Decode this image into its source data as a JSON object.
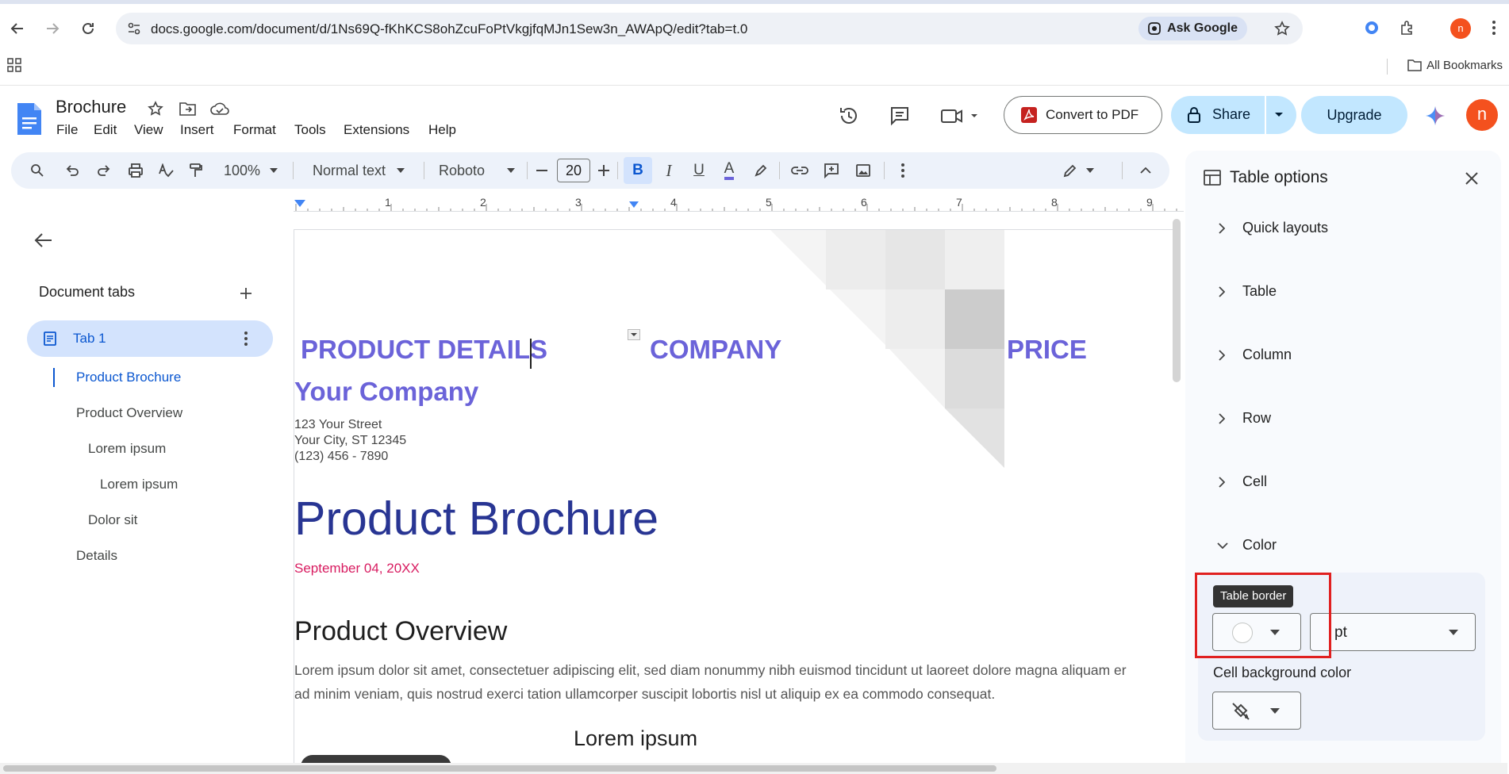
{
  "browser": {
    "url": "docs.google.com/document/d/1Ns69Q-fKhKCS8ohZcuFoPtVkgjfqMJn1Sew3n_AWApQ/edit?tab=t.0",
    "ask_google": "Ask Google",
    "all_bookmarks": "All Bookmarks",
    "profile_initial": "n"
  },
  "docs": {
    "title": "Brochure",
    "menu": [
      "File",
      "Edit",
      "View",
      "Insert",
      "Format",
      "Tools",
      "Extensions",
      "Help"
    ],
    "convert_pdf": "Convert to PDF",
    "share": "Share",
    "upgrade": "Upgrade",
    "avatar_initial": "n"
  },
  "toolbar": {
    "zoom": "100%",
    "style": "Normal text",
    "font": "Roboto",
    "font_size": "20",
    "bold": "B",
    "italic": "I",
    "underline": "U",
    "text_color": "A",
    "text_color_value": "#6b63d9"
  },
  "sidebar": {
    "heading": "Document tabs",
    "tab_label": "Tab 1",
    "outline": [
      {
        "label": "Product Brochure",
        "level": 0,
        "active": true
      },
      {
        "label": "Product Overview",
        "level": 0,
        "active": false
      },
      {
        "label": "Lorem ipsum",
        "level": 1,
        "active": false
      },
      {
        "label": "Lorem ipsum",
        "level": 2,
        "active": false
      },
      {
        "label": "Dolor sit",
        "level": 1,
        "active": false
      },
      {
        "label": "Details",
        "level": 0,
        "active": false
      }
    ]
  },
  "ruler": {
    "marks": [
      "1",
      "2",
      "3",
      "4",
      "5",
      "6",
      "7",
      "8",
      "9"
    ]
  },
  "document": {
    "header_cells": [
      "PRODUCT DETAILS",
      "COMPANY",
      "PRICE"
    ],
    "company_name": "Your Company",
    "address": [
      "123 Your Street",
      "Your City, ST 12345",
      "(123) 456 - 7890"
    ],
    "title": "Product Brochure",
    "date": "September 04, 20XX",
    "section_heading": "Product Overview",
    "body_lines": [
      "Lorem ipsum dolor sit amet, consectetuer adipiscing elit, sed diam nonummy nibh euismod tincidunt ut laoreet dolore magna aliquam er",
      "ad minim veniam, quis nostrud exerci tation ullamcorper suscipit lobortis nisl ut aliquip ex ea commodo consequat."
    ],
    "subheading": "Lorem ipsum",
    "accent_color": "#6b63d9",
    "title_color": "#283593",
    "date_color": "#d81b60"
  },
  "panel": {
    "title": "Table options",
    "sections": [
      {
        "label": "Quick layouts",
        "expanded": false
      },
      {
        "label": "Table",
        "expanded": false
      },
      {
        "label": "Column",
        "expanded": false
      },
      {
        "label": "Row",
        "expanded": false
      },
      {
        "label": "Cell",
        "expanded": false
      },
      {
        "label": "Color",
        "expanded": true
      }
    ],
    "tooltip": "Table border",
    "border_width_value": "pt",
    "cell_background_label": "Cell background color"
  }
}
